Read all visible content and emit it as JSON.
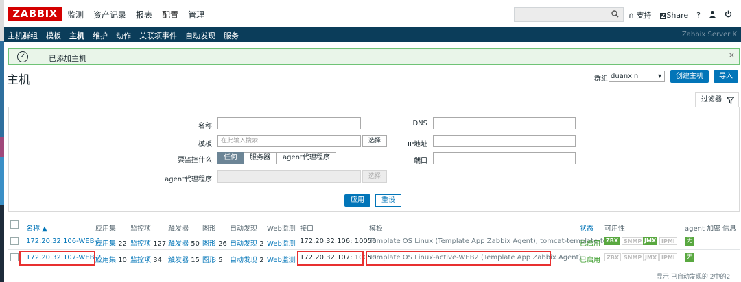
{
  "logo": "ZABBIX",
  "top_menu": [
    "监测",
    "资产记录",
    "报表",
    "配置",
    "管理"
  ],
  "top_links": {
    "support": "支持",
    "share": "Share",
    "help": "?"
  },
  "nav": [
    "主机群组",
    "模板",
    "主机",
    "维护",
    "动作",
    "关联项事件",
    "自动发现",
    "服务"
  ],
  "server_name": "Zabbix Server K",
  "message": "已添加主机",
  "page_title": "主机",
  "group_label": "群组",
  "group_value": "duanxin",
  "btn_create": "创建主机",
  "btn_import": "导入",
  "filter_tab": "过滤器",
  "filter": {
    "name_label": "名称",
    "template_label": "模板",
    "monitor_label": "要监控什么",
    "proxy_label": "agent代理程序",
    "dns_label": "DNS",
    "ip_label": "IP地址",
    "port_label": "端口",
    "template_placeholder": "在此输入搜索",
    "select_btn": "选择",
    "select_btn2": "选择",
    "seg": [
      "任何",
      "服务器",
      "agent代理程序"
    ],
    "apply": "应用",
    "reset": "重设"
  },
  "table": {
    "headers": {
      "name": "名称 ▲",
      "apps": "应用集",
      "items": "监控项",
      "triggers": "触发器",
      "graphs": "图形",
      "discovery": "自动发现",
      "web": "Web监测",
      "interface": "接口",
      "templates": "模板",
      "status": "状态",
      "availability": "可用性",
      "agent_enc": "agent 加密",
      "info": "信息"
    },
    "rows": [
      {
        "name": "172.20.32.106-WEB-1",
        "apps": "应用集",
        "apps_n": "22",
        "items": "监控项",
        "items_n": "127",
        "triggers": "触发器",
        "triggers_n": "50",
        "graphs": "图形",
        "graphs_n": "26",
        "discovery": "自动发现",
        "discovery_n": "2",
        "web": "Web监测",
        "interface": "172.20.32.106: 10050",
        "templates": "Template OS Linux (Template App Zabbix Agent), tomcat-template-test",
        "status": "已启用",
        "av": [
          "ZBX",
          "SNMP",
          "JMX",
          "IPMI"
        ],
        "enc": "无"
      },
      {
        "name": "172.20.32.107-WEB-2",
        "apps": "应用集",
        "apps_n": "10",
        "items": "监控项",
        "items_n": "34",
        "triggers": "触发器",
        "triggers_n": "15",
        "graphs": "图形",
        "graphs_n": "5",
        "discovery": "自动发现",
        "discovery_n": "2",
        "web": "Web监测",
        "interface": "172.20.32.107: 10050",
        "templates": "Template OS Linux-active-WEB2 (Template App Zabbix Agent)",
        "status": "已启用",
        "av": [
          "ZBX",
          "SNMP",
          "JMX",
          "IPMI"
        ],
        "enc": "无"
      }
    ]
  },
  "footer": "显示 已自动发现的 2中的2",
  "colors": {
    "brand": "#d40000",
    "nav": "#0b3d5a",
    "accent": "#0275b8",
    "ok": "#59a840",
    "highlight": "#e83030"
  }
}
